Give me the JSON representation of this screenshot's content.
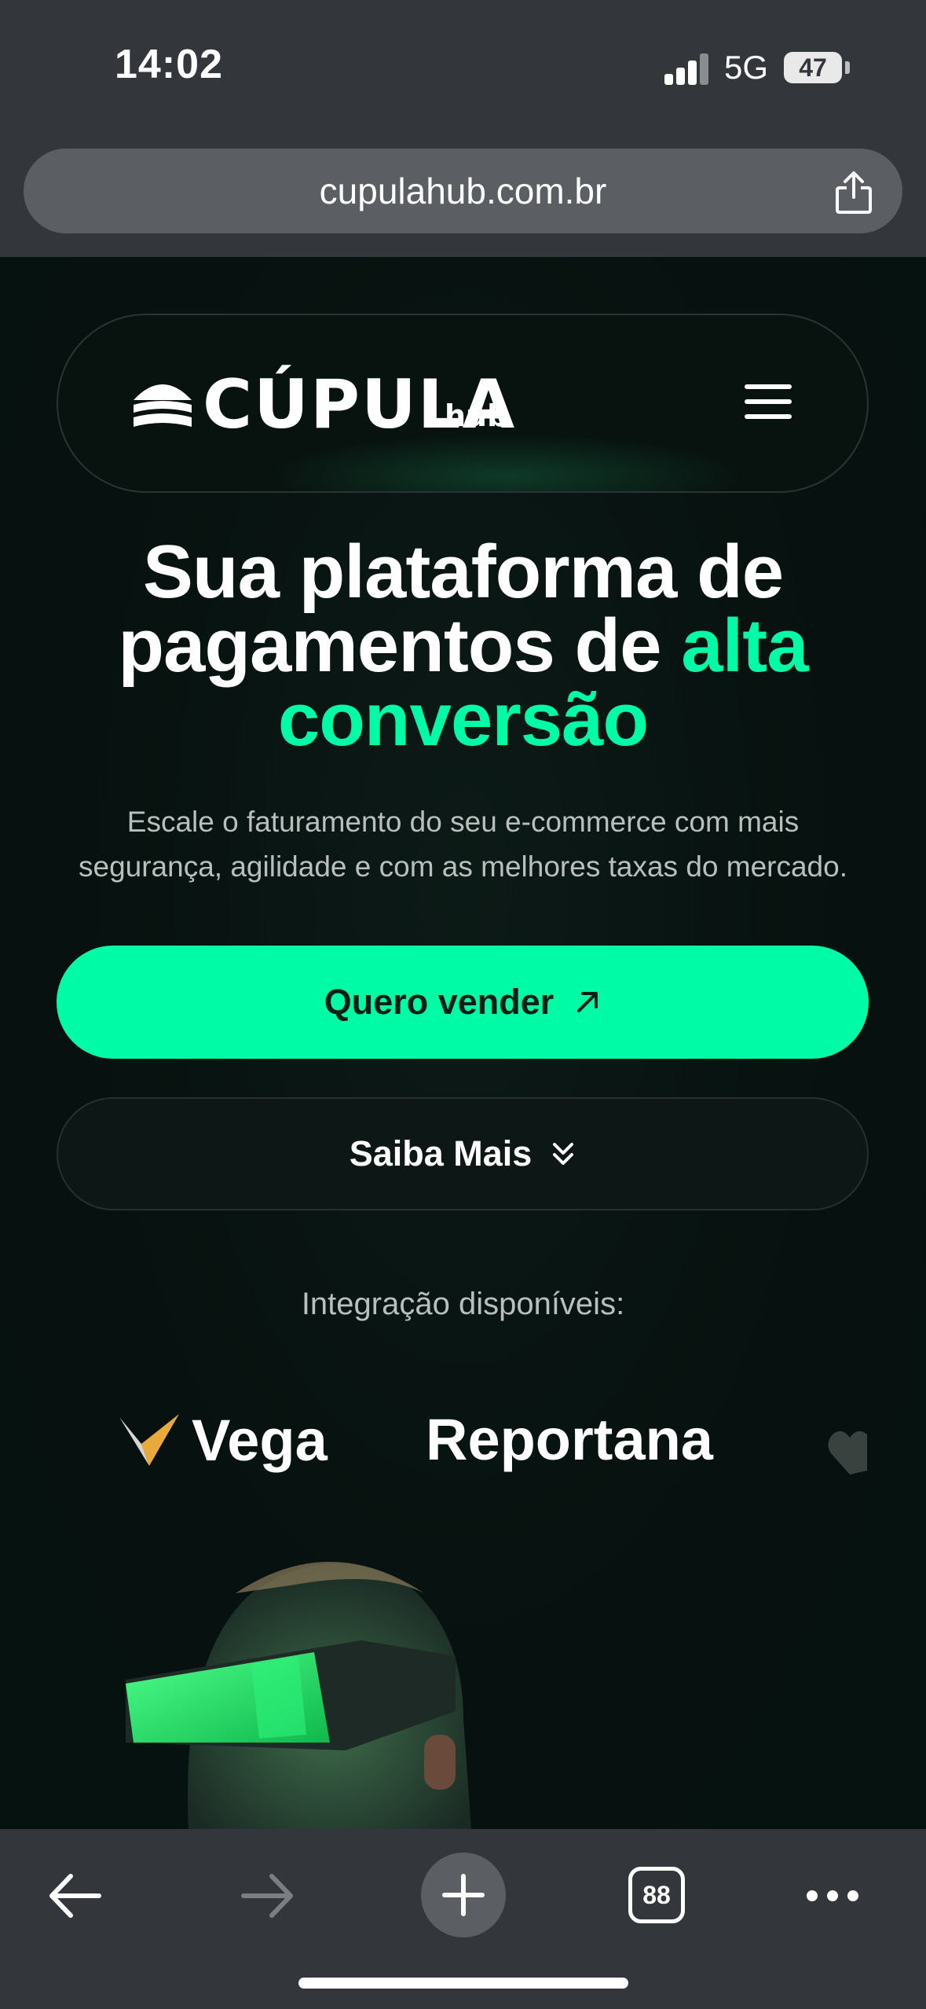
{
  "status_bar": {
    "time": "14:02",
    "network": "5G",
    "battery": "47"
  },
  "browser": {
    "url": "cupulahub.com.br",
    "tabs_count": "88"
  },
  "header": {
    "logo_text": "CÚPULA",
    "logo_suffix": "hub"
  },
  "hero": {
    "title_line1": "Sua plataforma de",
    "title_line2_plain": "pagamentos de ",
    "title_line2_accent": "alta",
    "title_line3_accent": "conversão",
    "subtitle_line1": "Escale o faturamento do seu e-commerce com mais",
    "subtitle_line2": "segurança, agilidade e com as melhores taxas do mercado.",
    "primary_button": "Quero vender",
    "secondary_button": "Saiba Mais"
  },
  "integrations": {
    "label": "Integração disponíveis:",
    "partners": [
      "Vega",
      "Reportana"
    ]
  },
  "colors": {
    "accent": "#00fba7",
    "page_bg": "#07110f",
    "browser_chrome": "#33373b"
  },
  "icons": [
    "signal-icon",
    "battery-icon",
    "share-icon",
    "hamburger-menu-icon",
    "arrow-up-right-icon",
    "chevrons-down-icon",
    "back-arrow-icon",
    "forward-arrow-icon",
    "plus-icon",
    "tabs-icon",
    "more-icon"
  ]
}
